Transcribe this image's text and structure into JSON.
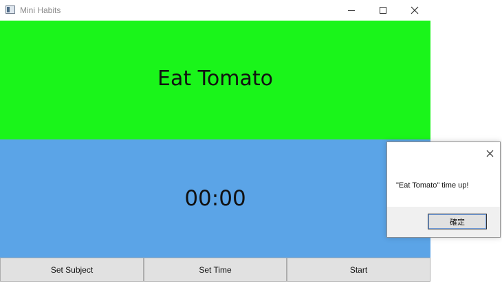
{
  "window": {
    "title": "Mini Habits"
  },
  "subject": {
    "text": "Eat Tomato",
    "background": "#1af51a"
  },
  "timer": {
    "text": "00:00",
    "background": "#5ba4e7"
  },
  "buttons": {
    "set_subject": "Set Subject",
    "set_time": "Set Time",
    "start": "Start"
  },
  "dialog": {
    "message": "\"Eat Tomato\" time up!",
    "ok_label": "確定"
  },
  "icons": {
    "app": "app-icon",
    "minimize": "minimize-icon",
    "maximize": "maximize-icon",
    "close": "close-icon"
  },
  "colors": {
    "window_border": "#c9c9c9",
    "button_face": "#e1e1e1",
    "dialog_footer": "#f0f0f0"
  }
}
